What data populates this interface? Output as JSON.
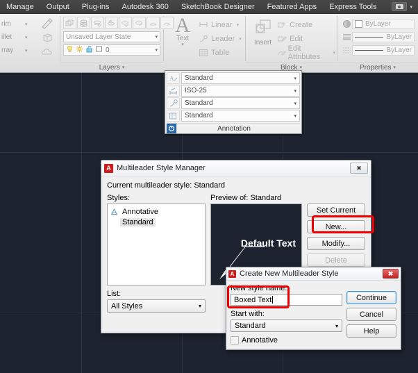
{
  "menubar": {
    "items": [
      "Manage",
      "Output",
      "Plug-ins",
      "Autodesk 360",
      "SketchBook Designer",
      "Featured Apps",
      "Express Tools"
    ],
    "share_icon": "camera-icon",
    "share_caret": "▾"
  },
  "ribbon": {
    "modify_panel": {
      "rows": [
        {
          "label": "rim",
          "caret": "▾"
        },
        {
          "label": "illet",
          "caret": "▾"
        },
        {
          "label": "rray",
          "caret": "▾"
        }
      ]
    },
    "layers_panel": {
      "title": "Layers",
      "caret": "▾",
      "tool_icons": [
        "layer-properties-icon",
        "layer-states-icon",
        "layer-off-icon",
        "layer-isolate-icon",
        "layer-freeze-icon",
        "layer-lock-icon",
        "layer-unisolate-icon",
        "layer-merge-icon"
      ],
      "layer_state_value": "Unsaved Layer State",
      "layer_state_caret": "▾",
      "layer_name_value": "0",
      "layer_name_caret": "▾",
      "status_icons": [
        "lightbulb-icon",
        "sun-icon",
        "unlock-icon",
        "color-swatch-icon"
      ]
    },
    "annotation_panel": {
      "text_icon": "A",
      "text_label": "Text",
      "text_caret": "▾",
      "items": [
        {
          "icon": "linear-dimension-icon",
          "label": "Linear",
          "caret": "▾"
        },
        {
          "icon": "leader-icon",
          "label": "Leader",
          "caret": "▾"
        },
        {
          "icon": "table-icon",
          "label": "Table",
          "caret": ""
        }
      ]
    },
    "block_panel": {
      "title": "Block",
      "caret": "▾",
      "insert_icon": "insert-block-icon",
      "insert_label": "Insert",
      "items": [
        {
          "icon": "create-block-icon",
          "label": "Create",
          "caret": ""
        },
        {
          "icon": "edit-block-icon",
          "label": "Edit",
          "caret": ""
        },
        {
          "icon": "edit-attributes-icon",
          "label": "Edit Attributes",
          "caret": "▾"
        }
      ]
    },
    "properties_panel": {
      "title": "Properties",
      "caret": "▾",
      "rows": [
        {
          "icon": "object-color-icon",
          "value": "ByLayer",
          "kind": "swatch"
        },
        {
          "icon": "lineweight-icon",
          "value": "ByLayer",
          "kind": "line"
        },
        {
          "icon": "linetype-icon",
          "value": "ByLayer",
          "kind": "line"
        }
      ]
    }
  },
  "annotation_flyout": {
    "title": "Annotation",
    "expander_icon": "panel-expand-icon",
    "rows": [
      {
        "icon": "text-style-icon",
        "value": "Standard",
        "caret": "▾"
      },
      {
        "icon": "dimension-style-icon",
        "value": "ISO-25",
        "caret": "▾"
      },
      {
        "icon": "multileader-style-icon",
        "value": "Standard",
        "caret": "▾"
      },
      {
        "icon": "table-style-icon",
        "value": "Standard",
        "caret": "▾"
      }
    ]
  },
  "dialog_multileader": {
    "title": "Multileader Style Manager",
    "logo_icon": "autodesk-logo-icon",
    "close_icon": "✖",
    "current_style_text": "Current multileader style: Standard",
    "styles_label": "Styles:",
    "styles_items": [
      {
        "label": "Annotative",
        "annotative": true,
        "selected": false
      },
      {
        "label": "Standard",
        "annotative": false,
        "selected": true
      }
    ],
    "preview_label": "Preview of: Standard",
    "preview_text": "Default Text",
    "list_label": "List:",
    "list_value": "All Styles",
    "list_caret": "▾",
    "buttons": [
      {
        "label": "Set Current",
        "enabled": true,
        "highlighted": false
      },
      {
        "label": "New...",
        "enabled": true,
        "highlighted": true
      },
      {
        "label": "Modify...",
        "enabled": true,
        "highlighted": false
      },
      {
        "label": "Delete",
        "enabled": false,
        "highlighted": false
      }
    ]
  },
  "dialog_create_style": {
    "title": "Create New Multileader Style",
    "logo_icon": "autodesk-logo-icon",
    "close_icon": "✖",
    "name_label": "New style name:",
    "name_value": "Boxed Text",
    "start_with_label": "Start with:",
    "start_with_value": "Standard",
    "start_with_caret": "▾",
    "annotative_label": "Annotative",
    "annotative_checked": false,
    "buttons": [
      {
        "label": "Continue",
        "focused": true
      },
      {
        "label": "Cancel",
        "focused": false
      },
      {
        "label": "Help",
        "focused": false
      }
    ]
  },
  "colors": {
    "canvas": "#1d2430",
    "menubar": "#3f3f3f",
    "ribbon": "#e9e9e9",
    "highlight_red": "#ee0000",
    "dialog_bg": "#f0f0f0",
    "autodesk_red": "#cf1b1b",
    "focus_blue": "#3c93d0"
  }
}
